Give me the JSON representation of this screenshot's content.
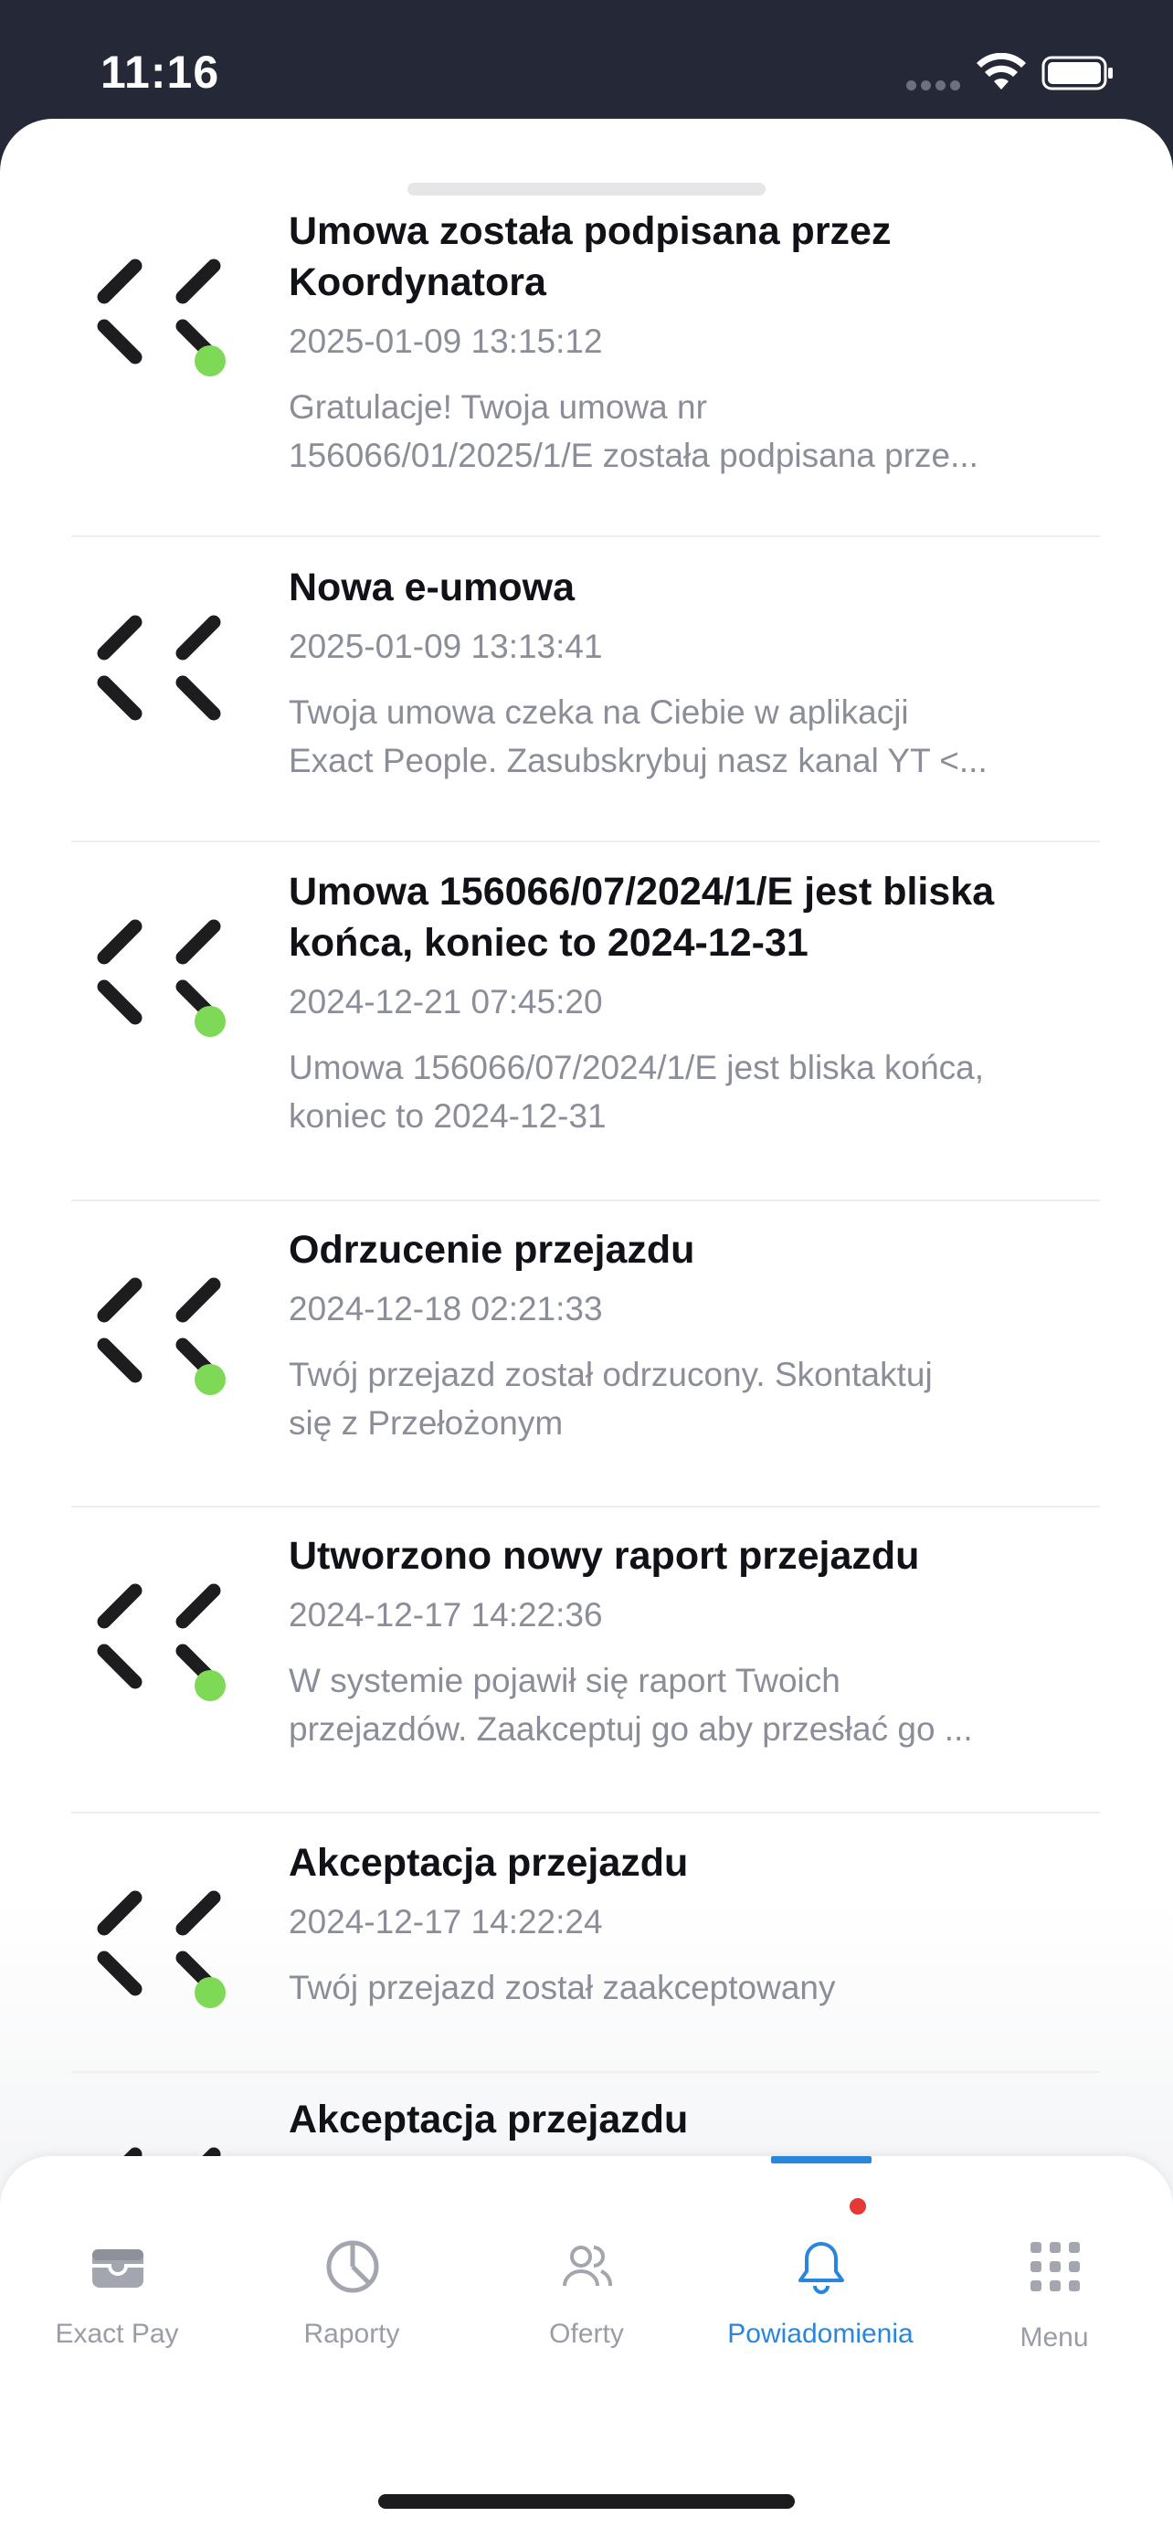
{
  "status": {
    "time": "11:16"
  },
  "notifications": [
    {
      "title_lines": [
        "Umowa została podpisana przez",
        "Koordynatora"
      ],
      "date": "2025-01-09 13:15:12",
      "body_lines": [
        "Gratulacje! Twoja umowa nr",
        "156066/01/2025/1/E została podpisana prze..."
      ],
      "unread": true
    },
    {
      "title_lines": [
        "Nowa e-umowa"
      ],
      "date": "2025-01-09 13:13:41",
      "body_lines": [
        "Twoja umowa czeka na Ciebie w aplikacji",
        "Exact People. Zasubskrybuj nasz kanal YT <..."
      ],
      "unread": false
    },
    {
      "title_lines": [
        "Umowa 156066/07/2024/1/E jest bliska",
        "końca, koniec to 2024-12-31"
      ],
      "date": "2024-12-21 07:45:20",
      "body_lines": [
        "Umowa 156066/07/2024/1/E jest bliska końca,",
        "koniec to 2024-12-31"
      ],
      "unread": true
    },
    {
      "title_lines": [
        "Odrzucenie przejazdu"
      ],
      "date": "2024-12-18 02:21:33",
      "body_lines": [
        "Twój przejazd został odrzucony. Skontaktuj",
        "się z Przełożonym"
      ],
      "unread": true
    },
    {
      "title_lines": [
        "Utworzono nowy raport przejazdu"
      ],
      "date": "2024-12-17 14:22:36",
      "body_lines": [
        "W systemie pojawił się raport Twoich",
        "przejazdów. Zaakceptuj go aby przesłać go ..."
      ],
      "unread": true
    },
    {
      "title_lines": [
        "Akceptacja przejazdu"
      ],
      "date": "2024-12-17 14:22:24",
      "body_lines": [
        "Twój przejazd został zaakceptowany"
      ],
      "unread": true
    },
    {
      "title_lines": [
        "Akceptacja przejazdu"
      ],
      "date": "",
      "body_lines": [],
      "unread": false
    }
  ],
  "tabs": [
    {
      "label": "Exact Pay",
      "icon": "wallet-icon",
      "active": false
    },
    {
      "label": "Raporty",
      "icon": "pie-chart-icon",
      "active": false
    },
    {
      "label": "Oferty",
      "icon": "users-icon",
      "active": false
    },
    {
      "label": "Powiadomienia",
      "icon": "bell-icon",
      "active": true,
      "badge": true
    },
    {
      "label": "Menu",
      "icon": "grid-icon",
      "active": false
    }
  ],
  "colors": {
    "accent": "#2a86dc",
    "unread_dot": "#7ed957",
    "badge": "#e53935",
    "status_bar": "#252836"
  }
}
